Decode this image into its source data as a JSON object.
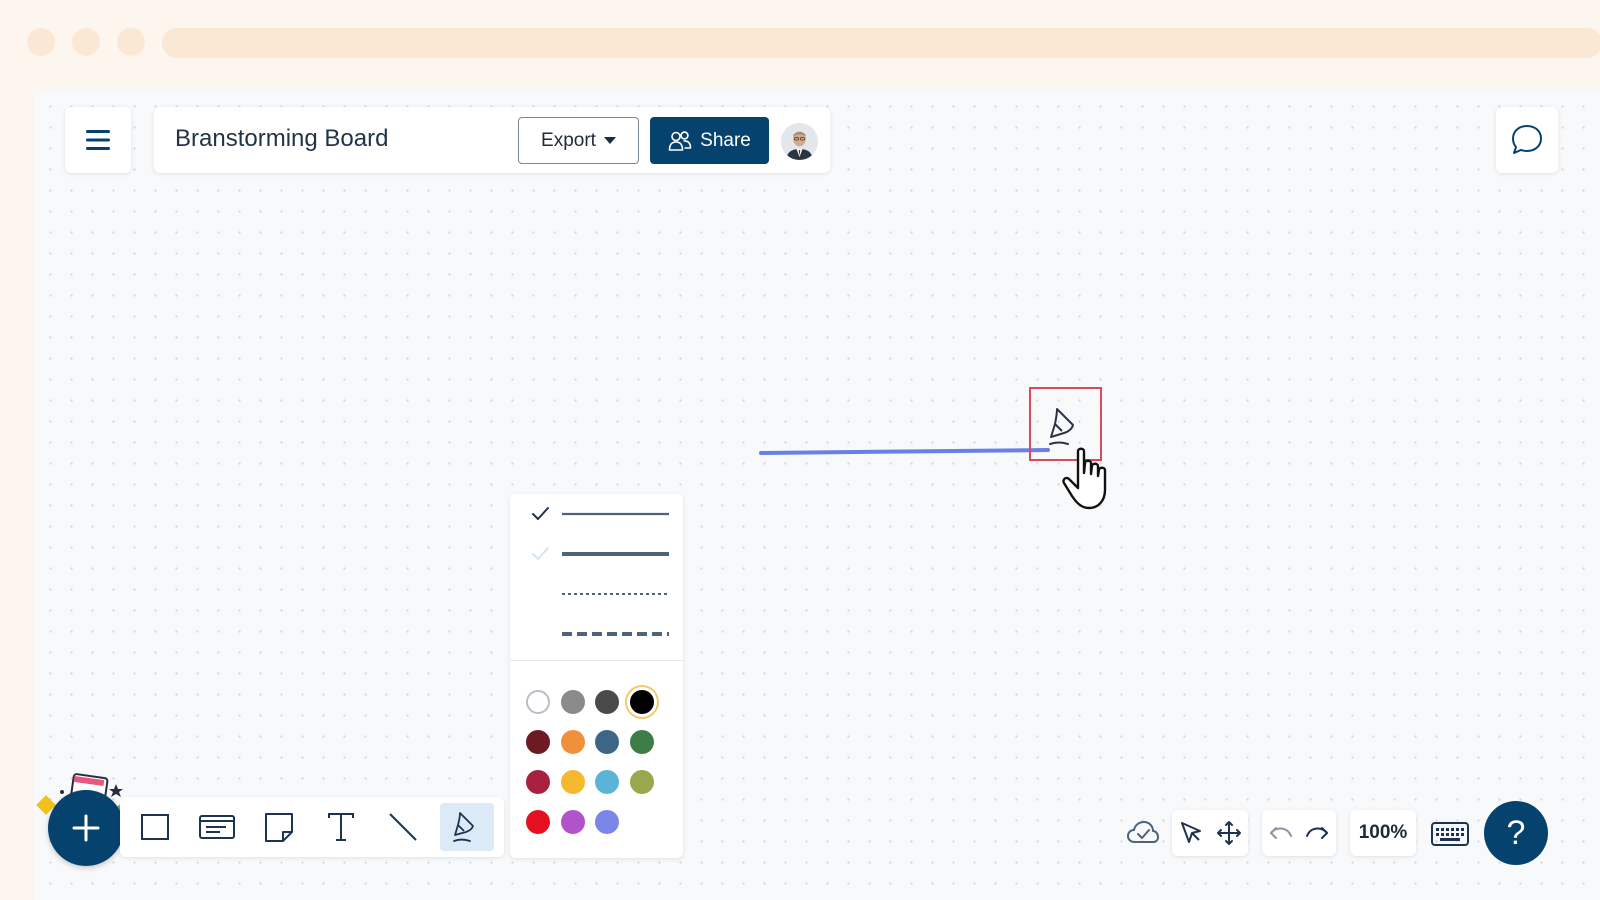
{
  "header": {
    "board_title": "Branstorming Board",
    "export_label": "Export",
    "share_label": "Share"
  },
  "status": {
    "zoom_level": "100%"
  },
  "help": {
    "label": "?"
  },
  "colors": {
    "accent": "#06426e",
    "stroke": "#6b7ee8",
    "highlight": "#d94a5f",
    "active_tool_bg": "#dceaf7"
  },
  "line_styles": [
    "thin-solid",
    "thick-solid",
    "dotted",
    "dashed"
  ],
  "selected_line_style": "thin-solid",
  "palette": [
    [
      "#ffffff",
      "#8a8a8a",
      "#4a4a4a",
      "#000000"
    ],
    [
      "#6e1a22",
      "#f0913a",
      "#3d6585",
      "#3f7d46"
    ],
    [
      "#a8223f",
      "#f4b92e",
      "#5bb4d8",
      "#98a84e"
    ],
    [
      "#e5101f",
      "#b253c9",
      "#7b87e8"
    ]
  ],
  "selected_color": "#000000",
  "tools": [
    "add-icon",
    "rectangle-icon",
    "card-icon",
    "sticky-note-icon",
    "text-icon",
    "line-icon",
    "pen-icon"
  ],
  "active_tool": "pen-icon"
}
